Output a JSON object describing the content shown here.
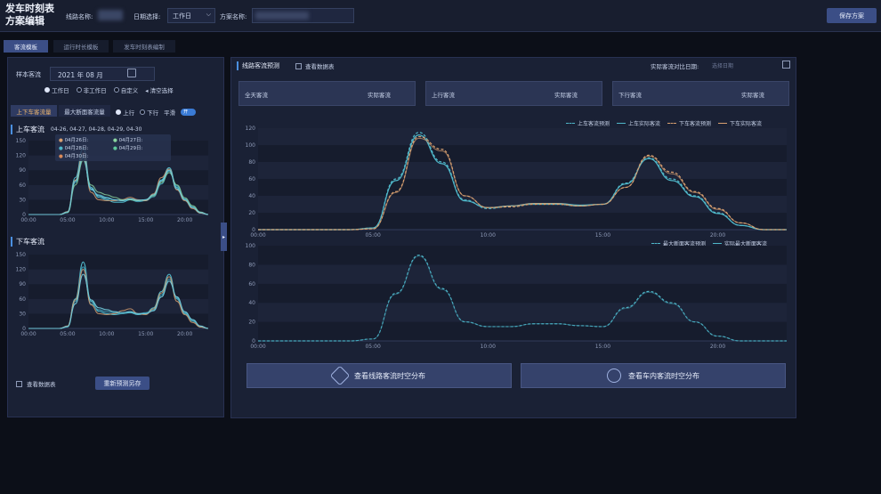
{
  "header": {
    "title_line1": "发车时刻表",
    "title_line2": "方案编辑",
    "route_label": "线路名称:",
    "date_label": "日期选择:",
    "date_value": "工作日",
    "plan_label": "方案名称:",
    "save_button": "保存方案"
  },
  "tabs": [
    "客流模板",
    "运行时长模板",
    "发车时刻表编制"
  ],
  "left_panel": {
    "sample_label": "样本客流",
    "month_value": "2021 年 08 月",
    "radios": [
      "工作日",
      "非工作日",
      "自定义"
    ],
    "clear_label": "清空选择",
    "subtabs": [
      "上下车客流量",
      "最大断面客流量"
    ],
    "direction": [
      "上行",
      "下行"
    ],
    "smooth_label": "平滑",
    "toggle_label": "开",
    "boarding_title": "上车客流",
    "boarding_dates": "04-26, 04-27, 04-28, 04-29, 04-30",
    "tooltip": [
      "04月26日:",
      "04月27日:",
      "04月28日:",
      "04月29日:",
      "04月30日:"
    ],
    "alighting_title": "下车客流",
    "view_table_label": "查看数据表",
    "repredict_button": "重新预测另存"
  },
  "right_panel": {
    "title": "线路客流预测",
    "view_table_label": "查看数据表",
    "compare_date_label": "实际客流对比日期:",
    "compare_date_placeholder": "选择日期",
    "cards": [
      {
        "label": "全天客流",
        "actual": "实际客流"
      },
      {
        "label": "上行客流",
        "actual": "实际客流"
      },
      {
        "label": "下行客流",
        "actual": "实际客流"
      }
    ],
    "legend_top": [
      "上车客流预测",
      "上车实际客流",
      "下车客流预测",
      "下车实际客流"
    ],
    "legend_bottom": [
      "最大断面客流预测",
      "实际最大断面客流"
    ],
    "button_spatial": "查看线路客流时空分布",
    "button_vehicle": "查看车内客流时空分布"
  },
  "colors": {
    "teal": "#4fb7c9",
    "orange": "#d9a070",
    "green": "#8cd6a0"
  },
  "chart_data": [
    {
      "type": "line",
      "title": "上车客流",
      "x": [
        "00:00",
        "01:00",
        "02:00",
        "03:00",
        "04:00",
        "05:00",
        "06:00",
        "07:00",
        "08:00",
        "09:00",
        "10:00",
        "11:00",
        "12:00",
        "13:00",
        "14:00",
        "15:00",
        "16:00",
        "17:00",
        "18:00",
        "19:00",
        "20:00",
        "21:00",
        "22:00",
        "23:00"
      ],
      "xticks": [
        "00:00",
        "05:00",
        "10:00",
        "15:00",
        "20:00"
      ],
      "ylim": [
        0,
        150
      ],
      "yticks": [
        0,
        30,
        60,
        90,
        120,
        150
      ],
      "series": [
        {
          "values": [
            0,
            0,
            0,
            0,
            0,
            5,
            75,
            135,
            55,
            35,
            30,
            25,
            25,
            30,
            28,
            30,
            40,
            70,
            95,
            55,
            30,
            15,
            3,
            0
          ]
        },
        {
          "values": [
            0,
            0,
            0,
            0,
            0,
            4,
            65,
            120,
            50,
            40,
            35,
            30,
            28,
            30,
            26,
            28,
            36,
            62,
            88,
            58,
            32,
            16,
            4,
            0
          ]
        },
        {
          "values": [
            0,
            0,
            0,
            0,
            0,
            6,
            70,
            125,
            45,
            30,
            28,
            28,
            30,
            35,
            30,
            28,
            42,
            75,
            92,
            50,
            28,
            12,
            3,
            0
          ]
        },
        {
          "values": [
            0,
            0,
            0,
            0,
            0,
            4,
            60,
            110,
            60,
            45,
            40,
            35,
            30,
            30,
            28,
            30,
            38,
            65,
            85,
            60,
            34,
            18,
            5,
            0
          ]
        },
        {
          "values": [
            0,
            0,
            0,
            0,
            0,
            5,
            68,
            115,
            52,
            38,
            33,
            30,
            28,
            32,
            29,
            30,
            40,
            68,
            90,
            52,
            30,
            14,
            4,
            0
          ]
        }
      ]
    },
    {
      "type": "line",
      "title": "下车客流",
      "x": [
        "00:00",
        "01:00",
        "02:00",
        "03:00",
        "04:00",
        "05:00",
        "06:00",
        "07:00",
        "08:00",
        "09:00",
        "10:00",
        "11:00",
        "12:00",
        "13:00",
        "14:00",
        "15:00",
        "16:00",
        "17:00",
        "18:00",
        "19:00",
        "20:00",
        "21:00",
        "22:00",
        "23:00"
      ],
      "xticks": [
        "00:00",
        "05:00",
        "10:00",
        "15:00",
        "20:00"
      ],
      "ylim": [
        0,
        150
      ],
      "yticks": [
        0,
        30,
        60,
        90,
        120,
        150
      ],
      "series": [
        {
          "values": [
            0,
            0,
            0,
            0,
            0,
            4,
            60,
            135,
            55,
            35,
            30,
            28,
            30,
            32,
            28,
            30,
            42,
            75,
            110,
            60,
            30,
            15,
            3,
            0
          ]
        },
        {
          "values": [
            0,
            0,
            0,
            0,
            0,
            3,
            55,
            125,
            50,
            38,
            34,
            32,
            30,
            34,
            30,
            32,
            38,
            68,
            100,
            62,
            32,
            16,
            4,
            0
          ]
        },
        {
          "values": [
            0,
            0,
            0,
            0,
            0,
            5,
            58,
            120,
            48,
            30,
            28,
            30,
            36,
            40,
            30,
            28,
            40,
            72,
            105,
            55,
            28,
            12,
            3,
            0
          ]
        },
        {
          "values": [
            0,
            0,
            0,
            0,
            0,
            4,
            50,
            110,
            58,
            42,
            38,
            34,
            32,
            34,
            30,
            30,
            36,
            64,
            96,
            64,
            34,
            18,
            5,
            0
          ]
        }
      ]
    },
    {
      "type": "line",
      "x": [
        "00:00",
        "01:00",
        "02:00",
        "03:00",
        "04:00",
        "05:00",
        "06:00",
        "07:00",
        "08:00",
        "09:00",
        "10:00",
        "11:00",
        "12:00",
        "13:00",
        "14:00",
        "15:00",
        "16:00",
        "17:00",
        "18:00",
        "19:00",
        "20:00",
        "21:00",
        "22:00",
        "23:00"
      ],
      "xticks": [
        "00:00",
        "05:00",
        "10:00",
        "15:00",
        "20:00"
      ],
      "ylim": [
        0,
        120
      ],
      "yticks": [
        0,
        20,
        40,
        60,
        80,
        100,
        120
      ],
      "series": [
        {
          "name": "上车客流预测",
          "values": [
            0,
            0,
            0,
            0,
            0,
            2,
            60,
            115,
            80,
            35,
            25,
            28,
            30,
            30,
            28,
            30,
            55,
            85,
            60,
            40,
            20,
            5,
            0,
            0
          ]
        },
        {
          "name": "上车实际客流",
          "values": [
            0,
            0,
            0,
            0,
            0,
            2,
            58,
            112,
            78,
            34,
            26,
            28,
            31,
            31,
            29,
            30,
            54,
            84,
            58,
            39,
            19,
            5,
            0,
            0
          ]
        },
        {
          "name": "下车客流预测",
          "values": [
            0,
            0,
            0,
            0,
            0,
            1,
            45,
            110,
            95,
            40,
            26,
            27,
            30,
            30,
            28,
            30,
            50,
            88,
            68,
            45,
            25,
            8,
            0,
            0
          ]
        },
        {
          "name": "下车实际客流",
          "values": [
            0,
            0,
            0,
            0,
            0,
            1,
            44,
            108,
            93,
            40,
            26,
            28,
            31,
            31,
            28,
            30,
            50,
            87,
            66,
            44,
            24,
            8,
            0,
            0
          ]
        }
      ]
    },
    {
      "type": "line",
      "x": [
        "00:00",
        "01:00",
        "02:00",
        "03:00",
        "04:00",
        "05:00",
        "06:00",
        "07:00",
        "08:00",
        "09:00",
        "10:00",
        "11:00",
        "12:00",
        "13:00",
        "14:00",
        "15:00",
        "16:00",
        "17:00",
        "18:00",
        "19:00",
        "20:00",
        "21:00",
        "22:00",
        "23:00"
      ],
      "xticks": [
        "00:00",
        "05:00",
        "10:00",
        "15:00",
        "20:00"
      ],
      "ylim": [
        0,
        100
      ],
      "yticks": [
        0,
        20,
        40,
        60,
        80,
        100
      ],
      "series": [
        {
          "name": "最大断面客流预测",
          "values": [
            0,
            0,
            0,
            0,
            0,
            2,
            50,
            90,
            55,
            20,
            15,
            15,
            18,
            18,
            16,
            15,
            35,
            52,
            40,
            20,
            5,
            0,
            0,
            0
          ]
        },
        {
          "name": "实际最大断面客流",
          "values": [
            0,
            0,
            0,
            0,
            0,
            2,
            49,
            89,
            54,
            20,
            15,
            15,
            18,
            18,
            16,
            15,
            34,
            51,
            39,
            20,
            5,
            0,
            0,
            0
          ]
        }
      ]
    }
  ]
}
